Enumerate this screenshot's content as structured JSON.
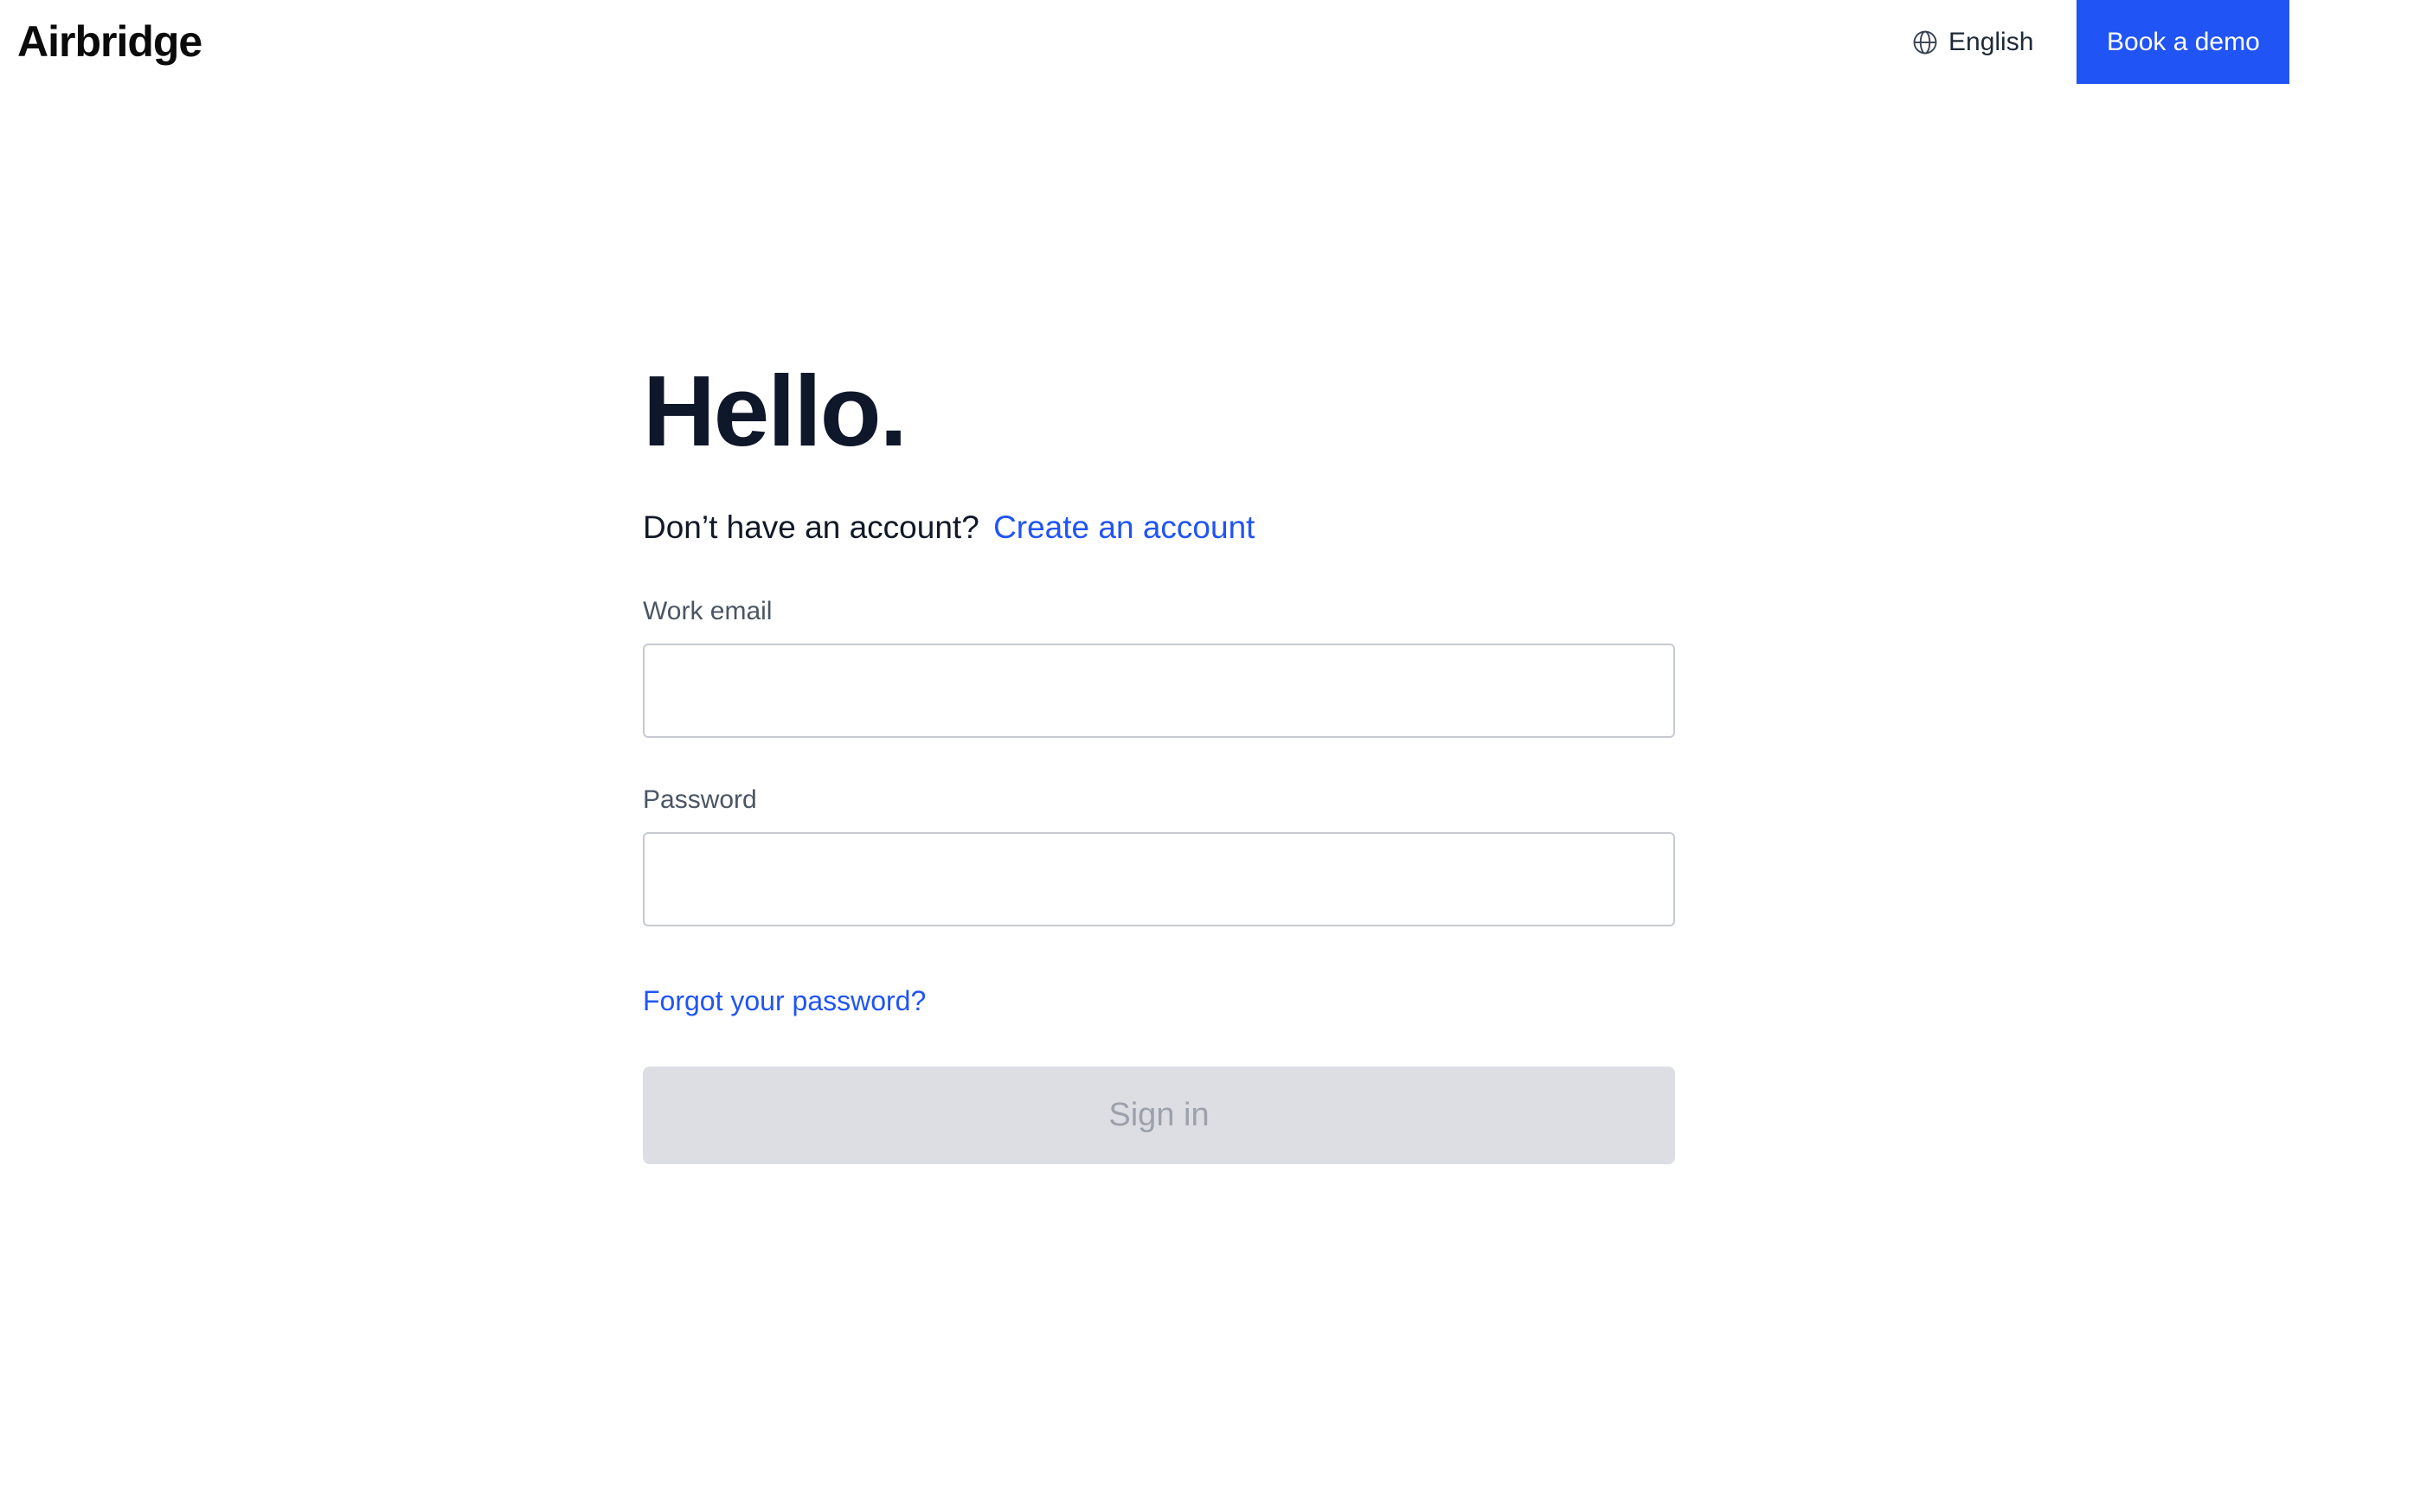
{
  "header": {
    "logo_text": "Airbridge",
    "language": {
      "icon": "globe-icon",
      "label": "English"
    },
    "demo_button_label": "Book a demo"
  },
  "login": {
    "title": "Hello.",
    "no_account_text": "Don’t have an account?",
    "create_account_link": "Create an account",
    "email": {
      "label": "Work email",
      "value": "",
      "placeholder": ""
    },
    "password": {
      "label": "Password",
      "value": "",
      "placeholder": ""
    },
    "forgot_password_link": "Forgot your password?",
    "sign_in_label": "Sign in"
  },
  "colors": {
    "accent": "#2054f5",
    "title": "#0f172a",
    "label": "#4b5563",
    "input_border": "#c7cad1",
    "disabled_button_bg": "#dcdee3",
    "disabled_button_text": "#9ca1ab"
  }
}
